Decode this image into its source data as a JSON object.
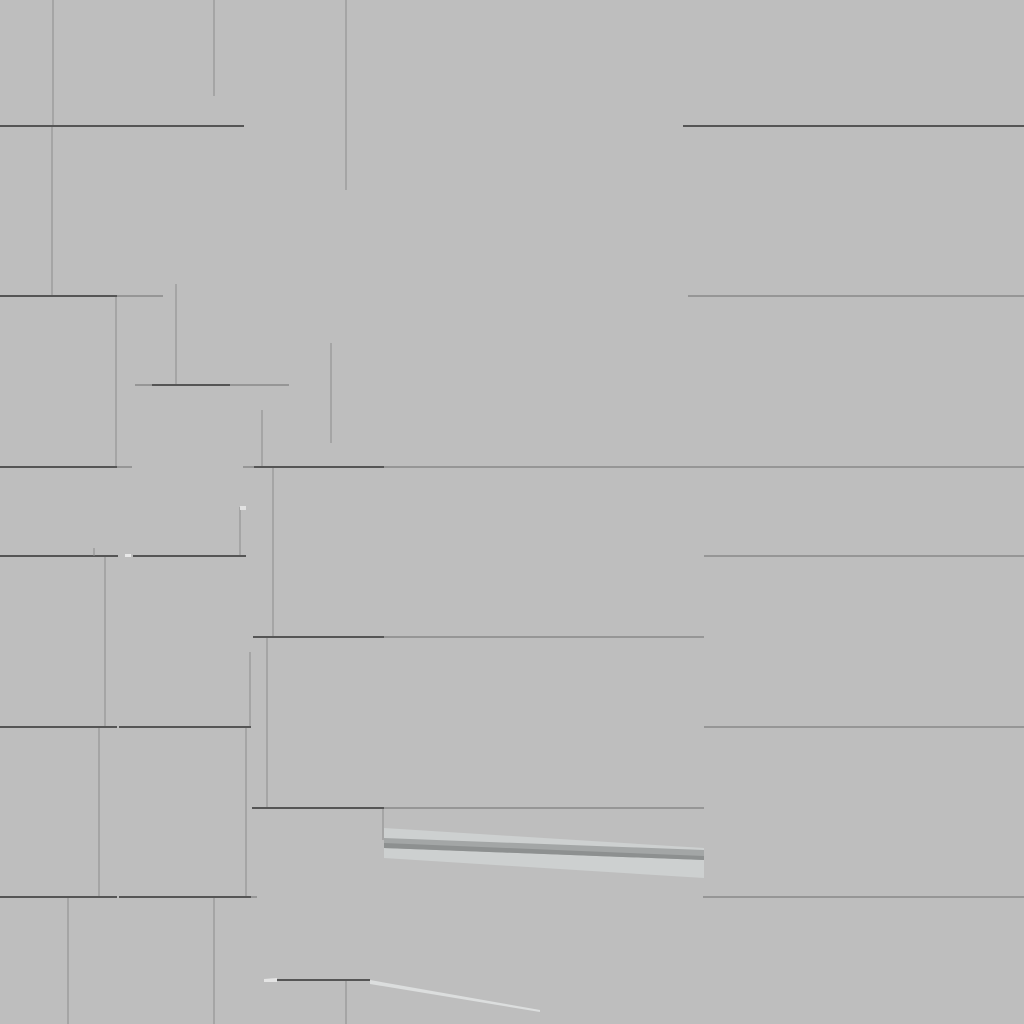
{
  "scene": {
    "background": "#bebebe",
    "colors": {
      "dark_edge": "#555555",
      "mid_edge": "#8a8a8a",
      "light_edge": "#9a9a9a",
      "thin_line": "#7a7a7a",
      "floor_shadow": "#a2a5a5",
      "floor_light": "#d3d6d6"
    }
  }
}
